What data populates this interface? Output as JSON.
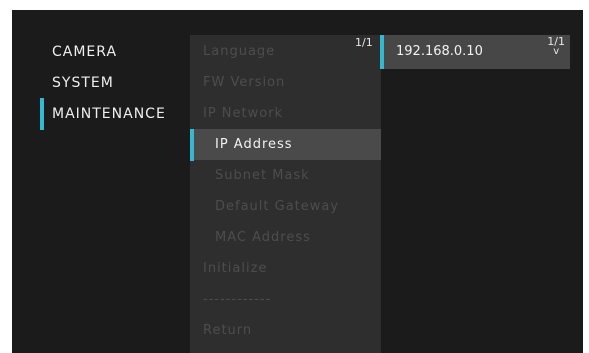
{
  "main_menu": {
    "items": [
      {
        "label": "CAMERA"
      },
      {
        "label": "SYSTEM"
      },
      {
        "label": "MAINTENANCE"
      }
    ]
  },
  "submenu": {
    "page": "1/1",
    "items": [
      {
        "label": "Language"
      },
      {
        "label": "FW Version"
      },
      {
        "label": "IP Network"
      },
      {
        "label": "IP Address"
      },
      {
        "label": "Subnet Mask"
      },
      {
        "label": "Default Gateway"
      },
      {
        "label": "MAC Address"
      },
      {
        "label": "Initialize"
      },
      {
        "label": "------------"
      },
      {
        "label": "Return"
      }
    ]
  },
  "value_panel": {
    "value": "192.168.0.10",
    "page": "1/1",
    "scroll_indicator": "v"
  },
  "colors": {
    "accent": "#35b9d0",
    "background": "#1b1b1b",
    "panel": "#2e2e2e",
    "selected": "#4a4a4a"
  }
}
